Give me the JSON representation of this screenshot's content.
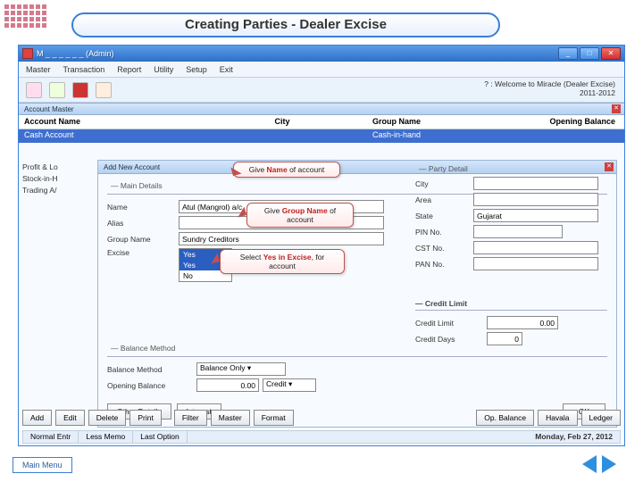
{
  "slide": {
    "title": "Creating Parties - Dealer Excise",
    "main_menu": "Main Menu"
  },
  "window": {
    "title": "M _ _ _ _ _ _ (Admin)",
    "welcome_l1": "? : Welcome to Miracle (Dealer Excise)",
    "welcome_l2": "2011-2012"
  },
  "menu": {
    "m1": "Master",
    "m2": "Transaction",
    "m3": "Report",
    "m4": "Utility",
    "m5": "Setup",
    "m6": "Exit"
  },
  "section": {
    "account_master": "Account Master",
    "add_new": "Add New Account"
  },
  "cols": {
    "c1": "Account Name",
    "c2": "City",
    "c3": "Group Name",
    "c4": "Opening Balance"
  },
  "row1": {
    "c1": "Cash Account",
    "c3": "Cash-in-hand"
  },
  "left_list": {
    "i1": "Profit & Lo",
    "i2": "Stock-in-H",
    "i3": "Trading A/"
  },
  "dialog": {
    "main_details": "— Main Details",
    "party_detail": "— Party Detail",
    "name_lbl": "Name",
    "name_val": "Atul (Mangrol) a/c",
    "alias_lbl": "Alias",
    "group_lbl": "Group Name",
    "group_val": "Sundry Creditors",
    "excise_lbl": "Excise",
    "sel_opt1": "Yes",
    "sel_opt2": "Yes",
    "sel_opt3": "No",
    "city_lbl": "City",
    "area_lbl": "Area",
    "state_lbl": "State",
    "state_val": "Gujarat",
    "pin_lbl": "PIN No.",
    "cst_lbl": "CST No.",
    "pan_lbl": "PAN No.",
    "credit_hdr": "— Credit Limit",
    "credit_limit_lbl": "Credit Limit",
    "credit_limit_val": "0.00",
    "credit_days_lbl": "Credit Days",
    "credit_days_val": "0",
    "balance_hdr": "— Balance Method",
    "balance_method_lbl": "Balance Method",
    "balance_method_val": "Balance Only",
    "opening_lbl": "Opening Balance",
    "opening_val": "0.00",
    "opening_type": "Credit",
    "btn1": "Other Details",
    "btn2": "Interest",
    "ok": "OK"
  },
  "callouts": {
    "c1_a": "Give ",
    "c1_b": "Name",
    "c1_c": " of account",
    "c2_a": "Give ",
    "c2_b": "Group Name",
    "c2_c": " of account",
    "c3_a": "Select ",
    "c3_b": "Yes in Excise",
    "c3_c": ", for account"
  },
  "footer": {
    "b1": "Add",
    "b2": "Edit",
    "b3": "Delete",
    "b4": "Print",
    "b5": "Filter",
    "b6": "Master",
    "b7": "Format",
    "r1": "Op. Balance",
    "r2": "Havala",
    "r3": "Ledger"
  },
  "status": {
    "s1": "Normal Entr",
    "s2": "Less Memo",
    "s3": "Last Option",
    "date": "Monday, Feb 27, 2012"
  }
}
